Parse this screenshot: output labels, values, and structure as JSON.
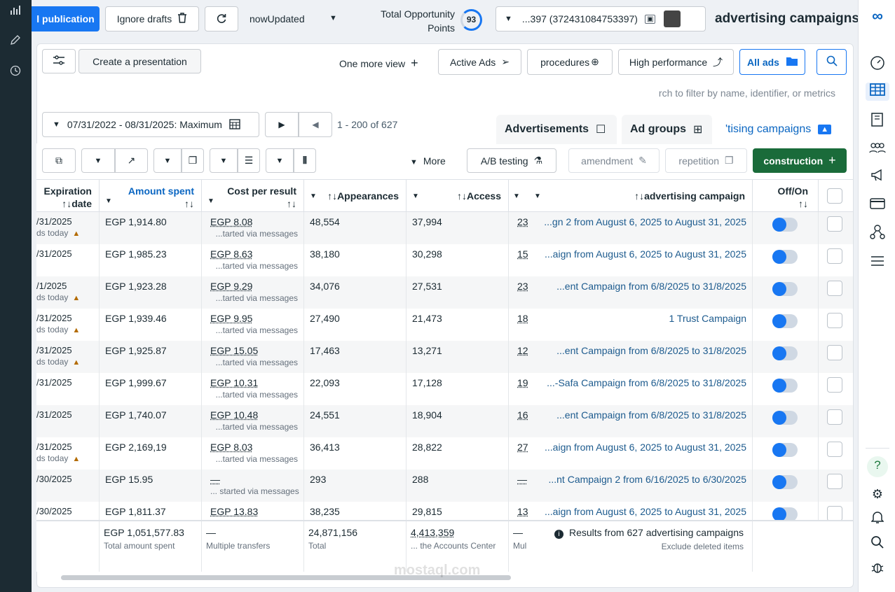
{
  "leftbar": {
    "icons": [
      "chart-icon",
      "pencil-icon",
      "clock-icon"
    ]
  },
  "topbar": {
    "publish_label": "l publication",
    "ignore_drafts_label": "Ignore drafts",
    "status_label": "nowUpdated",
    "opportunity_label_1": "Total Opportunity",
    "opportunity_label_2": "Points",
    "opportunity_score": "93",
    "account_label": "...397 (372431084753397)",
    "page_title": "advertising campaigns"
  },
  "toolbar1": {
    "create_presentation": "Create a presentation",
    "one_more_view": "One more view",
    "active_ads": "Active Ads",
    "procedures": "procedures",
    "high_performance": "High performance",
    "all_ads": "All ads"
  },
  "search": {
    "placeholder": "rch to filter by name, identifier, or metrics"
  },
  "date_range": "07/31/2022 - 08/31/2025: Maximum",
  "pagination": "1 - 200 of 627",
  "tabs": [
    "Advertisements",
    "Ad groups",
    "'tising campaigns"
  ],
  "toolbar2": {
    "more": "More",
    "ab_testing": "A/B testing",
    "amendment": "amendment",
    "repetition": "repetition",
    "construction": "construction"
  },
  "columns": {
    "expiration": "Expiration",
    "expiration2": "↑↓date",
    "amount_spent": "Amount spent",
    "cost_per_result": "Cost per result",
    "appearances": "↑↓Appearances",
    "access": "↑↓Access",
    "campaign": "↑↓advertising campaign",
    "offon": "Off/On"
  },
  "rows": [
    {
      "date": "/31/2025",
      "note": "ds today",
      "spent": "EGP 1,914.80",
      "cpr": "EGP 8.08",
      "cpr_sub": "...tarted via messages",
      "appear": "48,554",
      "access": "37,994",
      "res": "23",
      "campaign": "...gn 2 from August 6, 2025 to August 31, 2025"
    },
    {
      "date": "/31/2025",
      "note": "",
      "spent": "EGP 1,985.23",
      "cpr": "EGP 8.63",
      "cpr_sub": "...tarted via messages",
      "appear": "38,180",
      "access": "30,298",
      "res": "15",
      "campaign": "...aign from August 6, 2025 to August 31, 2025"
    },
    {
      "date": "/1/2025",
      "note": "ds today",
      "spent": "EGP 1,923.28",
      "cpr": "EGP 9.29",
      "cpr_sub": "...tarted via messages",
      "appear": "34,076",
      "access": "27,531",
      "res": "23",
      "campaign": "...ent Campaign from 6/8/2025 to 31/8/2025"
    },
    {
      "date": "/31/2025",
      "note": "ds today",
      "spent": "EGP 1,939.46",
      "cpr": "EGP 9.95",
      "cpr_sub": "...tarted via messages",
      "appear": "27,490",
      "access": "21,473",
      "res": "18",
      "campaign": "1 Trust Campaign"
    },
    {
      "date": "/31/2025",
      "note": "ds today",
      "spent": "EGP 1,925.87",
      "cpr": "EGP 15.05",
      "cpr_sub": "...tarted via messages",
      "appear": "17,463",
      "access": "13,271",
      "res": "12",
      "campaign": "...ent Campaign from 6/8/2025 to 31/8/2025"
    },
    {
      "date": "/31/2025",
      "note": "",
      "spent": "EGP 1,999.67",
      "cpr": "EGP 10.31",
      "cpr_sub": "...tarted via messages",
      "appear": "22,093",
      "access": "17,128",
      "res": "19",
      "campaign": "...-Safa Campaign from 6/8/2025 to 31/8/2025"
    },
    {
      "date": "/31/2025",
      "note": "",
      "spent": "EGP 1,740.07",
      "cpr": "EGP 10.48",
      "cpr_sub": "...tarted via messages",
      "appear": "24,551",
      "access": "18,904",
      "res": "16",
      "campaign": "...ent Campaign from 6/8/2025 to 31/8/2025"
    },
    {
      "date": "/31/2025",
      "note": "ds today",
      "spent": "EGP 2,169,19",
      "cpr": "EGP 8.03",
      "cpr_sub": "...tarted via messages",
      "appear": "36,413",
      "access": "28,822",
      "res": "27",
      "campaign": "...aign from August 6, 2025 to August 31, 2025"
    },
    {
      "date": "/30/2025",
      "note": "",
      "spent": "EGP 15.95",
      "cpr": "—",
      "cpr_sub": "... started via messages",
      "appear": "293",
      "access": "288",
      "res": "—",
      "campaign": "...nt Campaign 2 from 6/16/2025 to 6/30/2025"
    },
    {
      "date": "/30/2025",
      "note": "",
      "spent": "EGP 1,811.37",
      "cpr": "EGP 13.83",
      "cpr_sub": "",
      "appear": "38,235",
      "access": "29,815",
      "res": "13",
      "campaign": "...aign from August 6, 2025 to August 31, 2025"
    }
  ],
  "footer": {
    "spent": "EGP 1,051,577.83",
    "spent_label": "Total amount spent",
    "cpr": "—",
    "cpr_label": "Multiple transfers",
    "appear": "24,871,156",
    "appear_label": "Total",
    "access": "4,413,359",
    "access_label": "... the Accounts Center",
    "res": "—",
    "res_label": "Mul",
    "summary": "Results from 627 advertising campaigns",
    "summary_sub": "Exclude deleted items"
  },
  "watermark": "mostaql.com"
}
